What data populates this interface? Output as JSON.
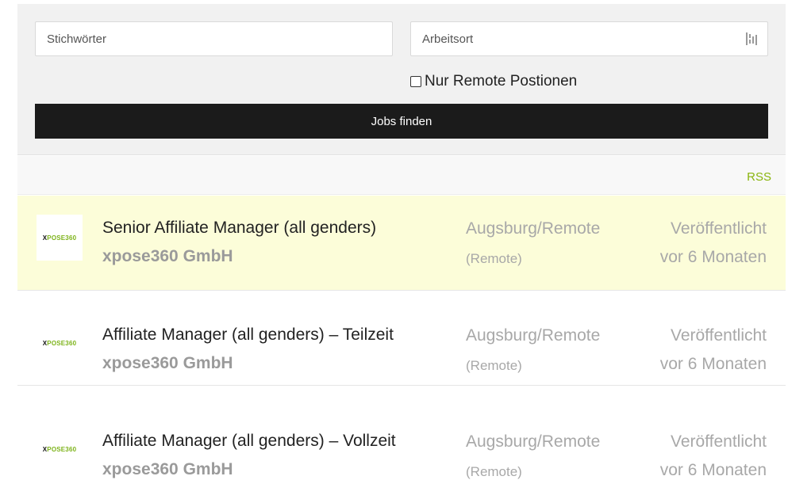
{
  "search": {
    "keywords_placeholder": "Stichwörter",
    "location_placeholder": "Arbeitsort",
    "remote_label": "Nur Remote Postionen",
    "submit_label": "Jobs finden"
  },
  "rss": {
    "label": "RSS"
  },
  "colors": {
    "accent": "#8ab50e",
    "highlight": "#fcfdd9",
    "button": "#1b1b1b"
  },
  "jobs": [
    {
      "title": "Senior Affiliate Manager (all genders)",
      "company": "xpose360 GmbH",
      "location": "Augsburg/Remote",
      "remote": "(Remote)",
      "date_line1": "Veröffentlicht",
      "date_line2": "vor 6 Monaten",
      "logo_x": "X",
      "logo_rest": "POSE360"
    },
    {
      "title": "Affiliate Manager (all genders) – Teilzeit",
      "company": "xpose360 GmbH",
      "location": "Augsburg/Remote",
      "remote": "(Remote)",
      "date_line1": "Veröffentlicht",
      "date_line2": "vor 6 Monaten",
      "logo_x": "X",
      "logo_rest": "POSE360"
    },
    {
      "title": "Affiliate Manager (all genders) – Vollzeit",
      "company": "xpose360 GmbH",
      "location": "Augsburg/Remote",
      "remote": "(Remote)",
      "date_line1": "Veröffentlicht",
      "date_line2": "vor 6 Monaten",
      "logo_x": "X",
      "logo_rest": "POSE360"
    }
  ]
}
